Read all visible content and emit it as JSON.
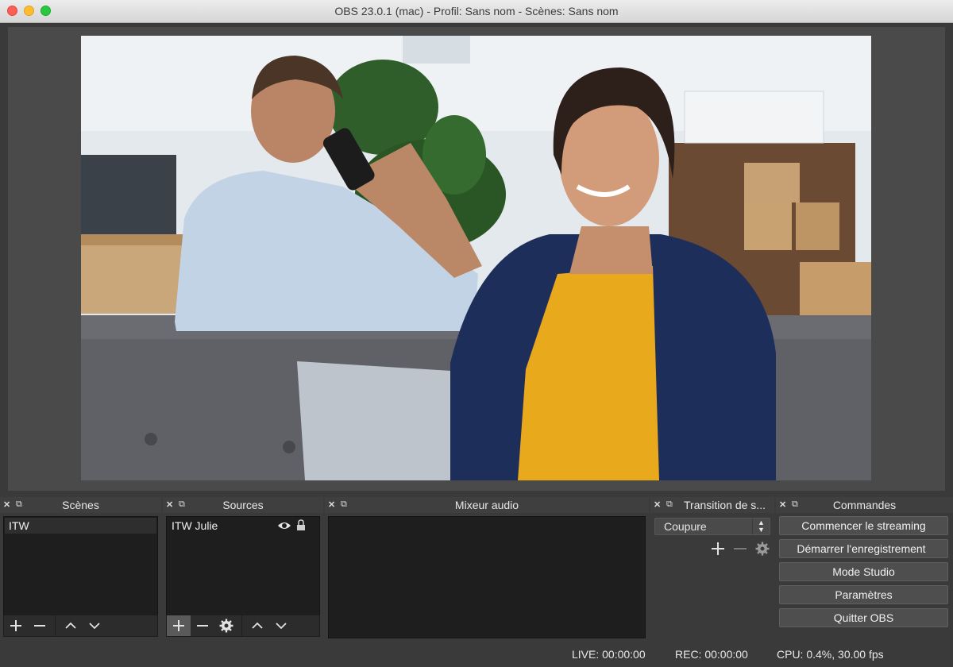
{
  "window": {
    "title": "OBS 23.0.1 (mac) - Profil: Sans nom - Scènes: Sans nom"
  },
  "docks": {
    "scenes": {
      "title": "Scènes",
      "items": [
        "ITW"
      ]
    },
    "sources": {
      "title": "Sources",
      "items": [
        {
          "label": "ITW Julie",
          "visible": true,
          "locked": false
        }
      ]
    },
    "mixer": {
      "title": "Mixeur audio"
    },
    "transitions": {
      "title": "Transition de s...",
      "selected": "Coupure"
    },
    "controls": {
      "title": "Commandes",
      "start_streaming": "Commencer le streaming",
      "start_recording": "Démarrer l'enregistrement",
      "studio_mode": "Mode Studio",
      "settings": "Paramètres",
      "exit": "Quitter OBS"
    }
  },
  "status": {
    "live": "LIVE: 00:00:00",
    "rec": "REC: 00:00:00",
    "cpu": "CPU: 0.4%, 30.00 fps"
  },
  "icons": {
    "plus": "plus-icon",
    "minus": "minus-icon",
    "gear": "gear-icon",
    "up": "chevron-up-icon",
    "down": "chevron-down-icon",
    "eye": "eye-icon",
    "lock": "lock-icon"
  },
  "colors": {
    "window_bg": "#3a3a3a",
    "panel_bg": "#1e1e1e",
    "button_bg": "#4e4e4e"
  }
}
